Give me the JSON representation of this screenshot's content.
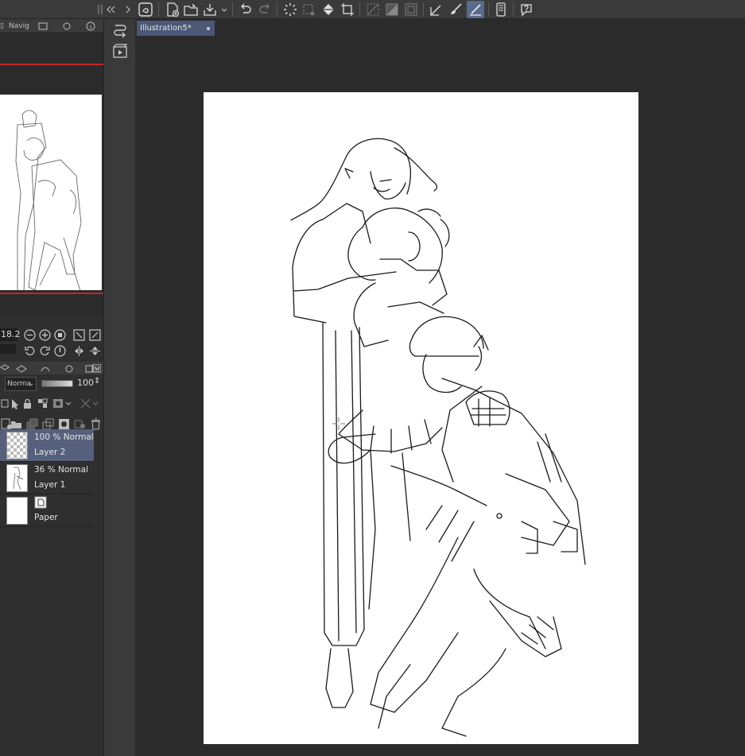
{
  "toolbar": {
    "icons": [
      "clip-studio-icon",
      "new-file-icon",
      "open-folder-icon",
      "save-icon",
      "undo-icon",
      "redo-icon",
      "loading-icon",
      "selection-icon",
      "fill-icon",
      "transform-icon",
      "hide-selection-icon",
      "invert-selection-icon",
      "clear-icon",
      "line-tool-icon",
      "brush-icon",
      "pen-active-icon",
      "device-icon",
      "help-icon"
    ]
  },
  "navigator": {
    "tab_label": "Navig",
    "zoom_value": "18.2"
  },
  "layer_panel": {
    "blend_mode": "Norma",
    "opacity": "100",
    "layers": [
      {
        "meta": "100 % Normal",
        "name": "Layer 2",
        "selected": true
      },
      {
        "meta": "36 % Normal",
        "name": "Layer 1",
        "selected": false
      },
      {
        "meta": "",
        "name": "Paper",
        "selected": false
      }
    ]
  },
  "canvas": {
    "document_tab": "Illustration5*"
  },
  "colors": {
    "accent": "#5a6a8c",
    "selected_layer": "#56607c",
    "navigator_frame": "#c3262b"
  }
}
